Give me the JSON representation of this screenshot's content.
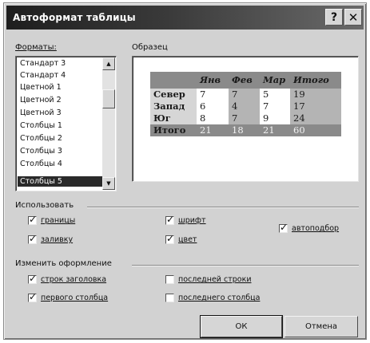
{
  "window": {
    "title": "Автоформат таблицы",
    "help_glyph": "?",
    "close_glyph": "✕"
  },
  "formats": {
    "label": "Форматы:",
    "items": [
      "Стандарт 3",
      "Стандарт 4",
      "Цветной 1",
      "Цветной 2",
      "Цветной 3",
      "Столбцы 1",
      "Столбцы 2",
      "Столбцы 3",
      "Столбцы 4",
      "Столбцы 5"
    ],
    "selected": "Столбцы 5",
    "scroll_up_glyph": "▲",
    "scroll_down_glyph": "▼"
  },
  "preview": {
    "label": "Образец",
    "header": [
      "",
      "Янв",
      "Фев",
      "Мар",
      "Итого"
    ],
    "rows": [
      [
        "Север",
        "7",
        "7",
        "5",
        "19"
      ],
      [
        "Запад",
        "6",
        "4",
        "7",
        "17"
      ],
      [
        "Юг",
        "8",
        "7",
        "9",
        "24"
      ],
      [
        "Итого",
        "21",
        "18",
        "21",
        "60"
      ]
    ]
  },
  "use": {
    "label": "Использовать",
    "borders": {
      "label": "границы",
      "checked": true
    },
    "fill": {
      "label": "заливку",
      "checked": true
    },
    "font": {
      "label": "шрифт",
      "checked": true
    },
    "color": {
      "label": "цвет",
      "checked": true
    },
    "autofit": {
      "label": "автоподбор",
      "checked": true
    }
  },
  "change": {
    "label": "Изменить оформление",
    "header_rows": {
      "label": "строк заголовка",
      "checked": true
    },
    "first_column": {
      "label": "первого столбца",
      "checked": true
    },
    "last_row": {
      "label": "последней строки",
      "checked": false
    },
    "last_column": {
      "label": "последнего столбца",
      "checked": false
    }
  },
  "buttons": {
    "ok": "ОК",
    "cancel": "Отмена"
  },
  "check_glyph": "✓"
}
